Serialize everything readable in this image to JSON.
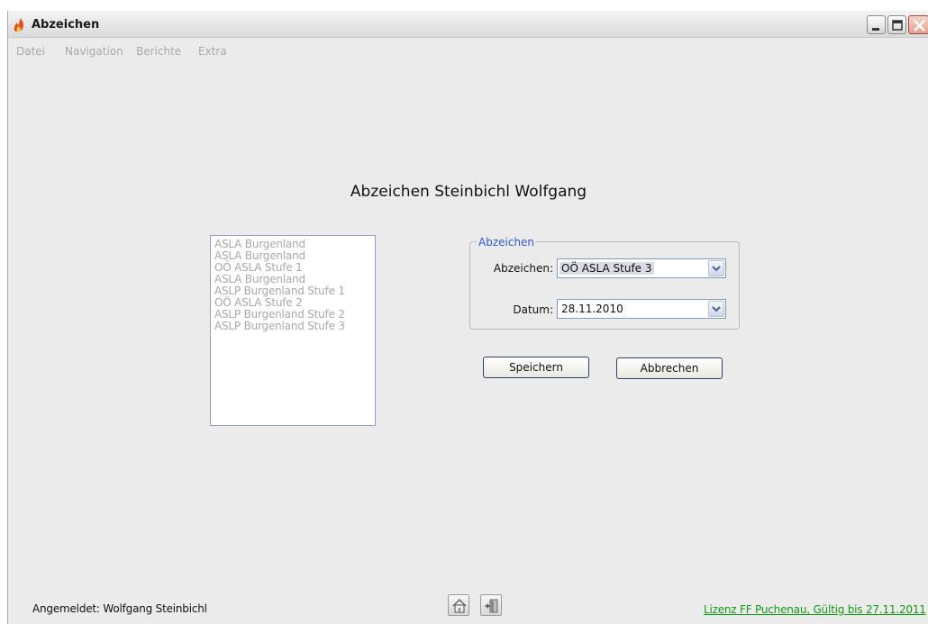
{
  "window": {
    "title": "Abzeichen"
  },
  "menu": {
    "items": [
      "Datei",
      "Navigation",
      "Berichte",
      "Extra"
    ]
  },
  "main": {
    "title": "Abzeichen Steinbichl Wolfgang",
    "list_items": [
      "ASLA Burgenland",
      "ASLA Burgenland",
      "OÖ ASLA Stufe 1",
      "ASLA Burgenland",
      "ASLP Burgenland Stufe 1",
      "OÖ ASLA Stufe 2",
      "ASLP Burgenland Stufe 2",
      "ASLP Burgenland Stufe 3"
    ],
    "group": {
      "legend": "Abzeichen",
      "abzeichen_label": "Abzeichen:",
      "abzeichen_value": "OÖ ASLA Stufe 3",
      "datum_label": "Datum:",
      "datum_value": "28.11.2010"
    },
    "buttons": {
      "save": "Speichern",
      "cancel": "Abbrechen"
    }
  },
  "status": {
    "user": "Angemeldet: Wolfgang Steinbichl",
    "license": "Lizenz FF Puchenau, Gültig bis 27.11.2011"
  },
  "icons": {
    "app": "flame-icon",
    "home": "home-icon",
    "exit": "exit-door-icon"
  },
  "colors": {
    "accent_blue": "#2d5bd6",
    "license_green": "#129a12",
    "disabled_gray": "#a8a8a8"
  }
}
